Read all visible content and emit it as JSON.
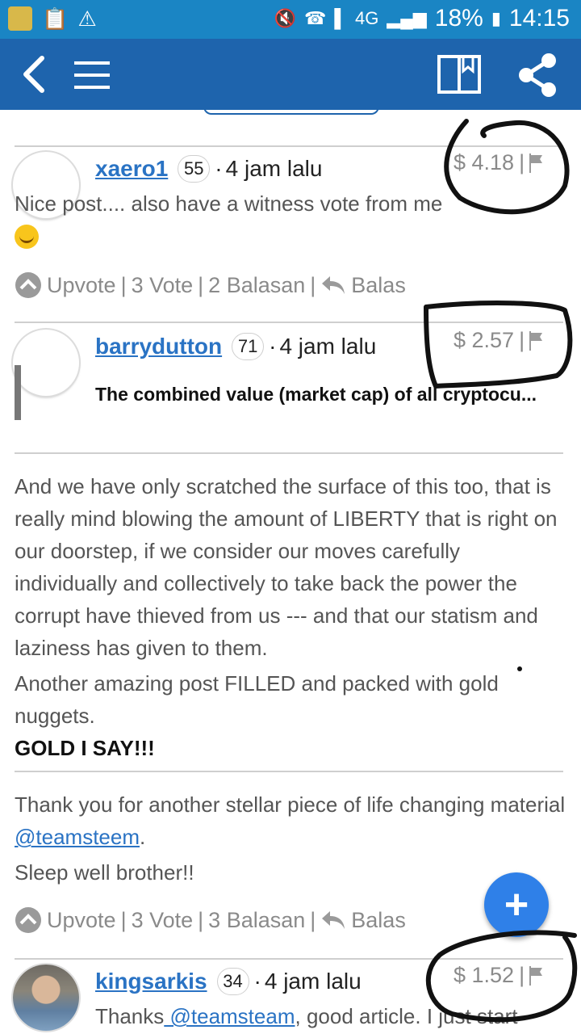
{
  "status_bar": {
    "network": "4G",
    "battery": "18%",
    "time": "14:15"
  },
  "app_bar": {
    "icons": [
      "back-arrow-icon",
      "menu-icon",
      "bookmark-book-icon",
      "share-icon"
    ]
  },
  "comments": [
    {
      "author": "xaero1",
      "reputation": "55",
      "time": "4 jam lalu",
      "payout": "$ 4.18",
      "text": "Nice post.... also have a witness vote from me",
      "actions": {
        "upvote": "Upvote",
        "votes": "3 Vote",
        "replies": "2 Balasan",
        "reply": "Balas"
      }
    },
    {
      "author": "barrydutton",
      "reputation": "71",
      "time": "4 jam lalu",
      "payout": "$ 2.57",
      "quote": "The combined value (market cap) of all cryptocu...",
      "paragraph1": "And we have only scratched the surface of this too, that is really mind blowing the amount of LIBERTY that is right on our doorstep, if we consider our moves carefully individually and collectively to take back the power the corrupt have thieved from us --- and that our statism and laziness has given to them.",
      "paragraph2": "Another amazing post FILLED and packed with gold nuggets.",
      "paragraph3": "GOLD I SAY!!!",
      "thanks_prefix": "Thank you for another stellar piece of life changing material",
      "thanks_mention": " @teamsteem",
      "thanks_suffix": ".",
      "sleep": "Sleep well brother!!",
      "actions": {
        "upvote": "Upvote",
        "votes": "3 Vote",
        "replies": "3 Balasan",
        "reply": "Balas"
      }
    },
    {
      "author": "kingsarkis",
      "reputation": "34",
      "time": "4 jam lalu",
      "payout": "$ 1.52",
      "text_prefix": "Thanks",
      "text_mention": " @teamsteam",
      "text_suffix": ", good article. I just start"
    }
  ],
  "fab": {
    "label": "+"
  },
  "colors": {
    "status_bar": "#1a85c4",
    "app_bar": "#1e64ad",
    "link": "#2a73c4",
    "fab": "#2f80e8"
  }
}
